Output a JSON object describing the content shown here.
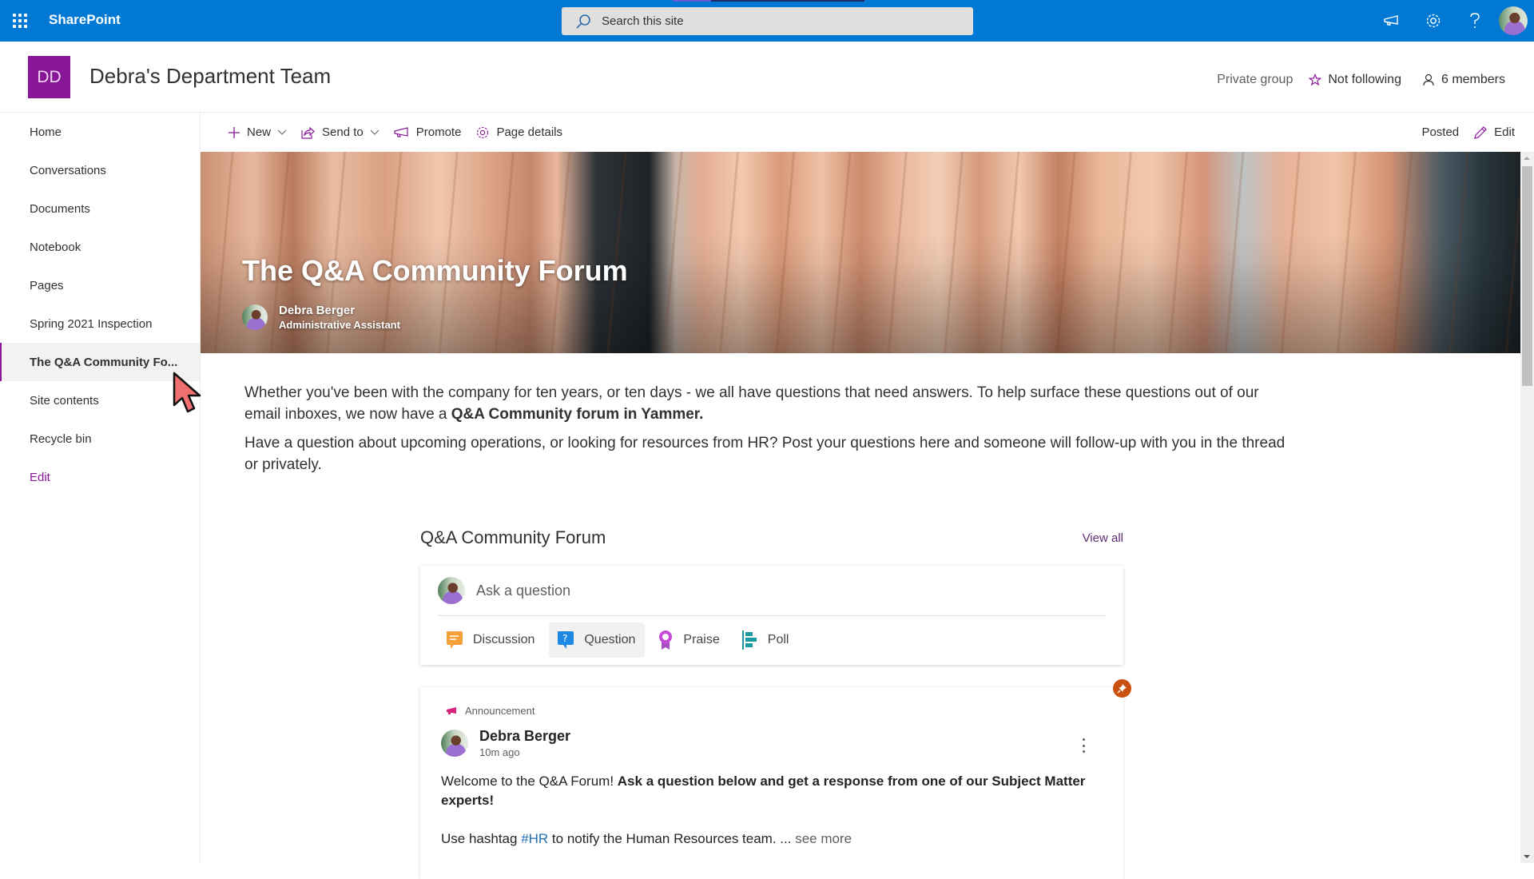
{
  "suitebar": {
    "app_name": "SharePoint",
    "search_placeholder": "Search this site",
    "icons": [
      "waffle-icon",
      "megaphone-icon",
      "settings-gear-icon",
      "help-icon",
      "profile-avatar"
    ]
  },
  "site": {
    "logo_initials": "DD",
    "title": "Debra's Department Team",
    "privacy": "Private group",
    "follow_label": "Not following",
    "members_label": "6 members",
    "accent_color": "#881798"
  },
  "nav": {
    "items": [
      {
        "label": "Home"
      },
      {
        "label": "Conversations"
      },
      {
        "label": "Documents"
      },
      {
        "label": "Notebook"
      },
      {
        "label": "Pages"
      },
      {
        "label": "Spring 2021 Inspection"
      },
      {
        "label": "The Q&A Community Fo...",
        "active": true
      },
      {
        "label": "Site contents"
      },
      {
        "label": "Recycle bin"
      }
    ],
    "edit_label": "Edit"
  },
  "commandbar": {
    "new_label": "New",
    "send_to_label": "Send to",
    "promote_label": "Promote",
    "page_details_label": "Page details",
    "status_label": "Posted",
    "edit_label": "Edit"
  },
  "hero": {
    "title": "The Q&A Community Forum",
    "author_name": "Debra Berger",
    "author_role": "Administrative Assistant"
  },
  "body": {
    "p1_text": "Whether you've been with the company for ten years, or ten days - we all have questions that need answers.  To help surface these questions out of our email inboxes, we now have a ",
    "p1_bold": "Q&A Community forum in Yammer.",
    "p2_text": "Have a question about upcoming operations, or looking for resources from HR?  Post your questions here and someone will follow-up with you in the thread or privately."
  },
  "yammer": {
    "title": "Q&A Community Forum",
    "view_all_label": "View all",
    "composer_placeholder": "Ask a question",
    "post_types": [
      {
        "label": "Discussion",
        "icon": "discussion-icon",
        "color": "#f7a03a"
      },
      {
        "label": "Question",
        "icon": "question-icon",
        "color": "#1e88e5",
        "selected": true
      },
      {
        "label": "Praise",
        "icon": "praise-ribbon-icon",
        "color": "#c54bd6"
      },
      {
        "label": "Poll",
        "icon": "poll-icon",
        "color": "#1a9ba1"
      }
    ],
    "post": {
      "type_label": "Announcement",
      "author": "Debra Berger",
      "time": "10m ago",
      "text_intro": "Welcome to the Q&A Forum!  ",
      "text_bold": "Ask a question below and get a response from one of our Subject Matter experts!",
      "line2_prefix": "Use hashtag ",
      "hashtag": "#HR",
      "line2_suffix": " to notify the Human Resources team. ... ",
      "see_more_label": "see more",
      "pinned": true
    }
  }
}
